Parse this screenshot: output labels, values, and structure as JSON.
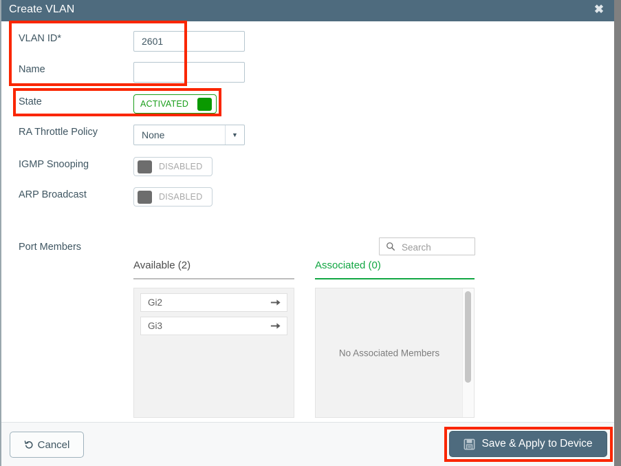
{
  "window": {
    "title": "Create VLAN",
    "close_label": "✖"
  },
  "form": {
    "vlan_id": {
      "label": "VLAN ID*",
      "value": "2601",
      "placeholder": ""
    },
    "name": {
      "label": "Name",
      "value": "",
      "placeholder": ""
    },
    "state": {
      "label": "State",
      "toggle_text": "ACTIVATED",
      "enabled": true
    },
    "ra_throttle_policy": {
      "label": "RA Throttle Policy",
      "selected": "None"
    },
    "igmp_snooping": {
      "label": "IGMP Snooping",
      "toggle_text": "DISABLED",
      "enabled": false
    },
    "arp_broadcast": {
      "label": "ARP Broadcast",
      "toggle_text": "DISABLED",
      "enabled": false
    }
  },
  "port_members": {
    "label": "Port Members",
    "search": {
      "placeholder": "Search",
      "value": ""
    },
    "available": {
      "title": "Available (2)",
      "items": [
        {
          "label": "Gi2"
        },
        {
          "label": "Gi3"
        }
      ]
    },
    "associated": {
      "title": "Associated (0)",
      "empty_text": "No Associated Members",
      "items": []
    }
  },
  "footer": {
    "cancel_label": "Cancel",
    "save_label": "Save & Apply to Device"
  },
  "colors": {
    "header_bg": "#4e6b7e",
    "accent_green": "#11a642",
    "toggle_on": "#0a9900",
    "annotation_red": "#fa2600",
    "label_text": "#3f5662"
  }
}
